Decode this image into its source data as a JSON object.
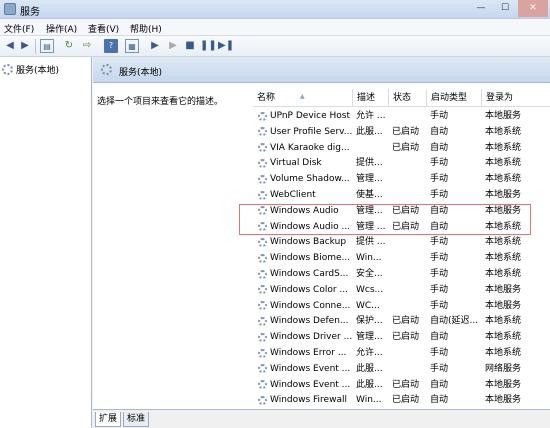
{
  "window": {
    "title": "服务",
    "minimize": "—",
    "maximize": "☐",
    "close": "✕"
  },
  "menu": [
    "文件(F)",
    "操作(A)",
    "查看(V)",
    "帮助(H)"
  ],
  "toolbar_icons": [
    "back-arrow",
    "forward-arrow",
    "console-tree",
    "refresh",
    "export",
    "help",
    "properties",
    "start",
    "start-disabled",
    "stop",
    "pause",
    "restart"
  ],
  "tree": {
    "root": "服务(本地)"
  },
  "pane": {
    "title": "服务(本地)",
    "description": "选择一个项目来查看它的描述。"
  },
  "columns": [
    "名称",
    "描述",
    "状态",
    "启动类型",
    "登录为"
  ],
  "services": [
    {
      "name": "UPnP Device Host",
      "desc": "允许 ...",
      "status": "",
      "startup": "手动",
      "logon": "本地服务"
    },
    {
      "name": "User Profile Serv...",
      "desc": "此服...",
      "status": "已启动",
      "startup": "自动",
      "logon": "本地系统"
    },
    {
      "name": "VIA Karaoke dig...",
      "desc": "",
      "status": "已启动",
      "startup": "自动",
      "logon": "本地系统"
    },
    {
      "name": "Virtual Disk",
      "desc": "提供...",
      "status": "",
      "startup": "手动",
      "logon": "本地系统"
    },
    {
      "name": "Volume Shadow...",
      "desc": "管理...",
      "status": "",
      "startup": "手动",
      "logon": "本地系统"
    },
    {
      "name": "WebClient",
      "desc": "使基...",
      "status": "",
      "startup": "手动",
      "logon": "本地服务"
    },
    {
      "name": "Windows Audio",
      "desc": "管理...",
      "status": "已启动",
      "startup": "自动",
      "logon": "本地服务"
    },
    {
      "name": "Windows Audio ...",
      "desc": "管理 ...",
      "status": "已启动",
      "startup": "自动",
      "logon": "本地系统"
    },
    {
      "name": "Windows Backup",
      "desc": "提供 ...",
      "status": "",
      "startup": "手动",
      "logon": "本地系统"
    },
    {
      "name": "Windows Biome...",
      "desc": "Win...",
      "status": "",
      "startup": "手动",
      "logon": "本地系统"
    },
    {
      "name": "Windows CardS...",
      "desc": "安全...",
      "status": "",
      "startup": "手动",
      "logon": "本地系统"
    },
    {
      "name": "Windows Color ...",
      "desc": "Wcs...",
      "status": "",
      "startup": "手动",
      "logon": "本地服务"
    },
    {
      "name": "Windows Conne...",
      "desc": "WC...",
      "status": "",
      "startup": "手动",
      "logon": "本地服务"
    },
    {
      "name": "Windows Defen...",
      "desc": "保护...",
      "status": "已启动",
      "startup": "自动(延迟...",
      "logon": "本地系统"
    },
    {
      "name": "Windows Driver ...",
      "desc": "管理...",
      "status": "已启动",
      "startup": "自动",
      "logon": "本地系统"
    },
    {
      "name": "Windows Error ...",
      "desc": "允许...",
      "status": "",
      "startup": "手动",
      "logon": "本地系统"
    },
    {
      "name": "Windows Event ...",
      "desc": "此服...",
      "status": "",
      "startup": "手动",
      "logon": "网络服务"
    },
    {
      "name": "Windows Event ...",
      "desc": "此服...",
      "status": "已启动",
      "startup": "自动",
      "logon": "本地服务"
    },
    {
      "name": "Windows Firewall",
      "desc": "Win...",
      "status": "已启动",
      "startup": "自动",
      "logon": "本地服务"
    }
  ],
  "tabs": [
    "扩展",
    "标准"
  ],
  "colors": {
    "highlight_border": "#e57373",
    "header_bg": "#c6d7ec"
  }
}
